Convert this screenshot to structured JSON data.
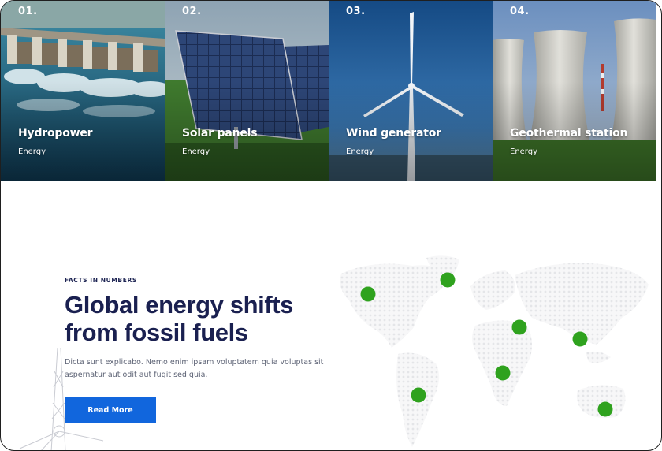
{
  "projects": [
    {
      "number": "01.",
      "title": "Hydropower",
      "category": "Energy"
    },
    {
      "number": "02.",
      "title": "Solar panels",
      "category": "Energy"
    },
    {
      "number": "03.",
      "title": "Wind generator",
      "category": "Energy"
    },
    {
      "number": "04.",
      "title": "Geothermal station",
      "category": "Energy"
    }
  ],
  "facts": {
    "eyebrow": "FACTS IN NUMBERS",
    "heading": "Global energy shifts from fossil fuels",
    "description": "Dicta sunt explicabo. Nemo enim ipsam voluptatem quia voluptas sit aspernatur aut odit aut fugit sed quia.",
    "button_label": "Read More"
  },
  "colors": {
    "accent": "#1166dd",
    "heading": "#1a2050",
    "marker": "#2fa21e"
  },
  "icons": [
    "world-map-icon",
    "location-marker-icon",
    "wind-turbine-outline-icon"
  ]
}
